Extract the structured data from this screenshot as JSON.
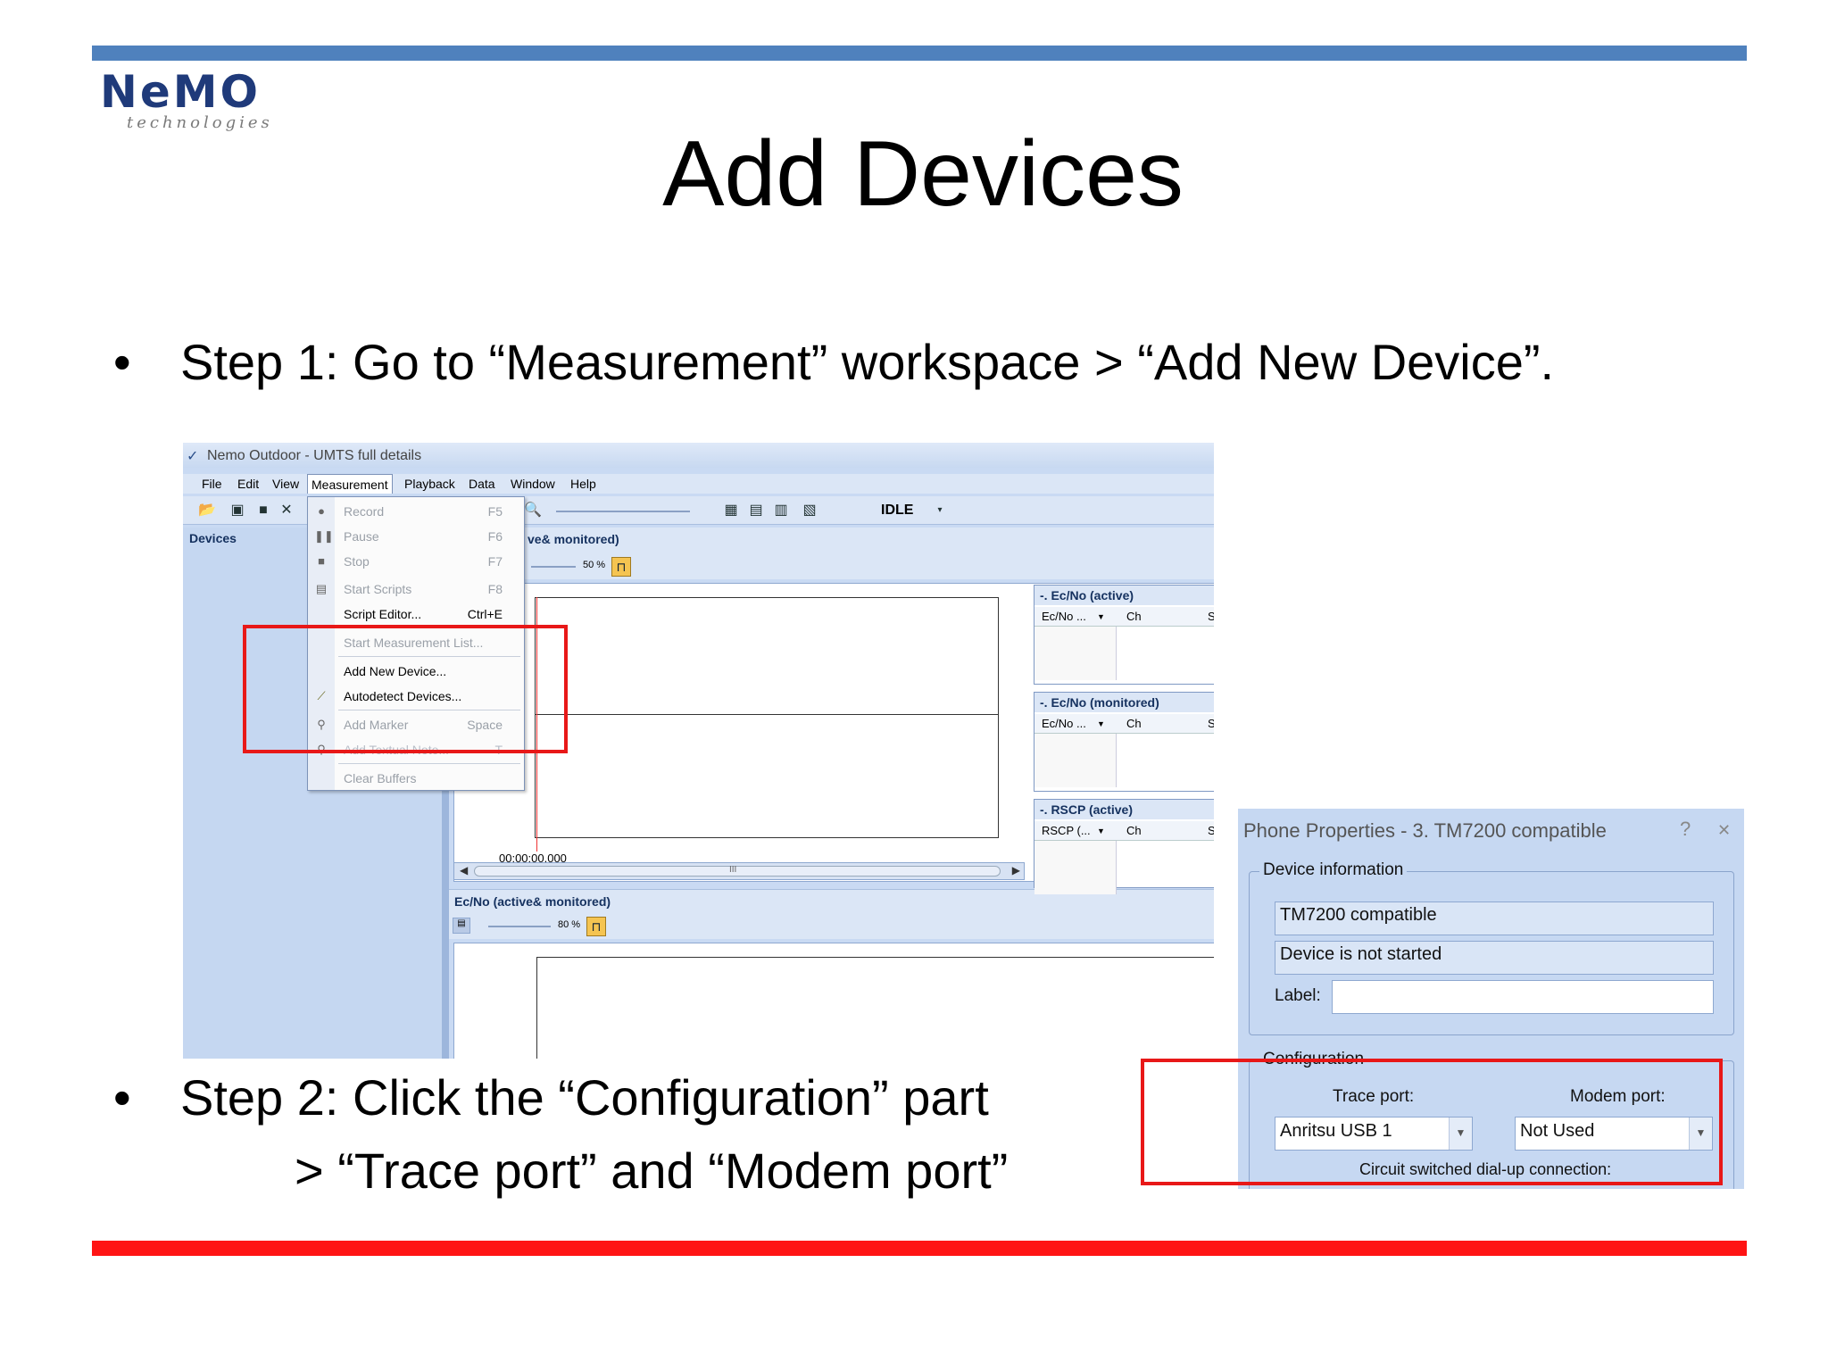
{
  "slide": {
    "title": "Add Devices",
    "step1": "Step 1: Go to “Measurement” workspace > “Add New Device”.",
    "step2_line1": "Step 2: Click the “Configuration” part",
    "step2_line2": "> “Trace port” and “Modem port”",
    "bullet": "•"
  },
  "logo": {
    "word": "NeMO",
    "sub": "technologies"
  },
  "colors": {
    "top_bar": "#4f81bd",
    "bottom_bar": "#ff1414",
    "highlight": "#e81818",
    "app_background": "#c9daf3"
  },
  "app": {
    "title": "Nemo Outdoor - UMTS full details",
    "menu": [
      "File",
      "Edit",
      "View",
      "Measurement",
      "Playback",
      "Data",
      "Window",
      "Help"
    ],
    "status": "IDLE",
    "left_panel_label": "Devices",
    "pane1_title": "ve& monitored)",
    "pane1_zoom": "50 %",
    "time_label": "00:00:00.000",
    "pane2_title": "Ec/No (active& monitored)",
    "pane2_zoom": "80 %",
    "scroll_label": "III",
    "ec_panels": [
      {
        "title": "-. Ec/No (active)",
        "col1": "Ec/No ...",
        "col2": "Ch",
        "col3": "S"
      },
      {
        "title": "-. Ec/No (monitored)",
        "col1": "Ec/No ...",
        "col2": "Ch",
        "col3": "S"
      },
      {
        "title": "-. RSCP (active)",
        "col1": "RSCP (...",
        "col2": "Ch",
        "col3": "S"
      }
    ]
  },
  "measurement_menu": [
    {
      "label": "Record",
      "shortcut": "F5",
      "icon": "record-icon"
    },
    {
      "label": "Pause",
      "shortcut": "F6",
      "icon": "pause-icon"
    },
    {
      "label": "Stop",
      "shortcut": "F7",
      "icon": "stop-icon"
    },
    {
      "label": "Start Scripts",
      "shortcut": "F8",
      "icon": "script-icon"
    },
    {
      "label": "Script Editor...",
      "shortcut": "Ctrl+E",
      "icon": ""
    },
    {
      "label": "Start Measurement List...",
      "shortcut": "",
      "icon": ""
    },
    {
      "label": "Add New Device...",
      "shortcut": "",
      "icon": ""
    },
    {
      "label": "Autodetect Devices...",
      "shortcut": "",
      "icon": "wand-icon"
    },
    {
      "label": "Add Marker",
      "shortcut": "Space",
      "icon": "marker-icon"
    },
    {
      "label": "Add Textual Note...",
      "shortcut": "T",
      "icon": "note-icon"
    },
    {
      "label": "Clear Buffers",
      "shortcut": "",
      "icon": ""
    }
  ],
  "dialog": {
    "title": "Phone Properties - 3. TM7200 compatible",
    "help": "?",
    "close": "✕",
    "device_info_group": "Device information",
    "device_name": "TM7200 compatible",
    "device_status": "Device is not started",
    "label_caption": "Label:",
    "label_value": "",
    "config_group": "Configuration",
    "trace_port_label": "Trace port:",
    "trace_port_value": "Anritsu USB 1",
    "modem_port_label": "Modem port:",
    "modem_port_value": "Not Used",
    "circuit_label": "Circuit switched dial-up connection:"
  }
}
